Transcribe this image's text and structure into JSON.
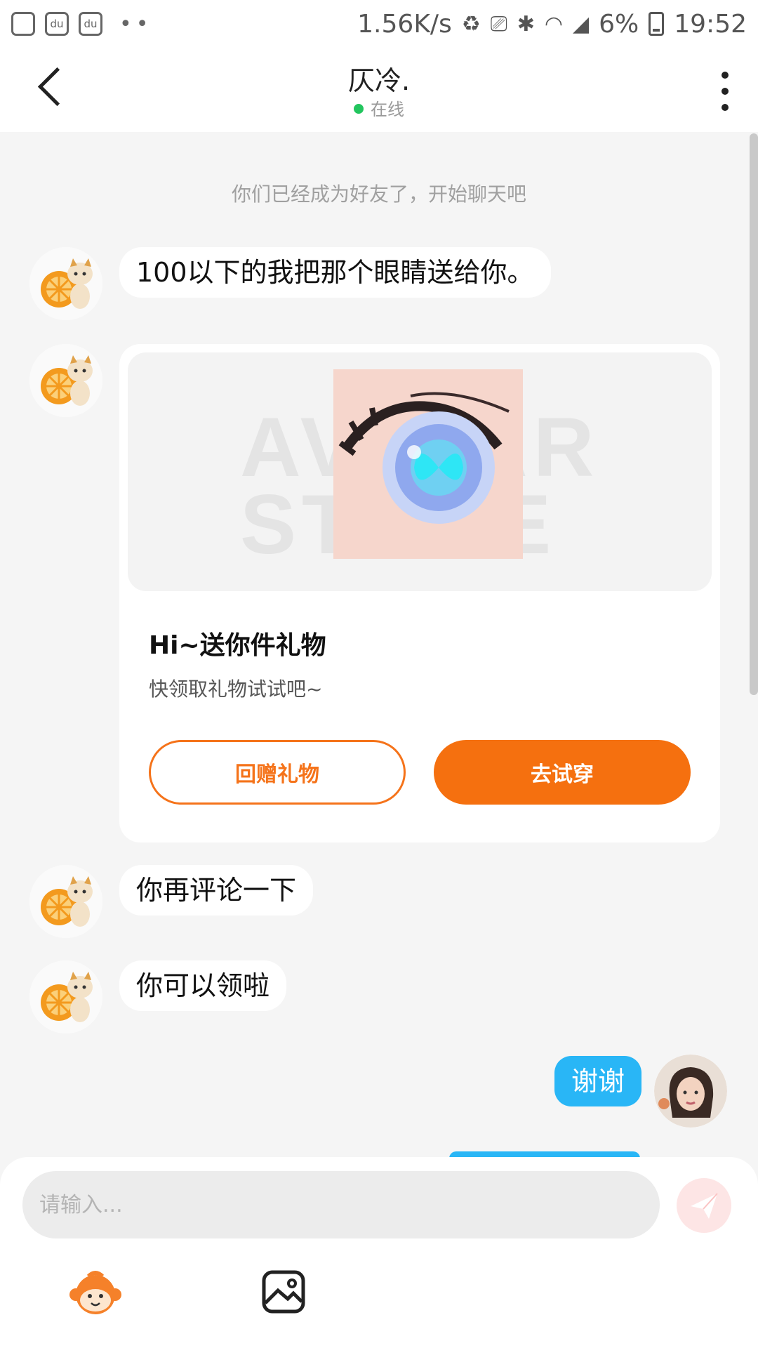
{
  "status_bar": {
    "speed": "1.56K/s",
    "battery": "6%",
    "time": "19:52",
    "icons": [
      "screen-record-icon",
      "baidu-icon",
      "baidu-icon",
      "more-dots-icon",
      "battery-saver-icon",
      "cast-icon",
      "bluetooth-icon",
      "wifi-icon",
      "signal-icon",
      "battery-icon"
    ]
  },
  "header": {
    "title": "仄冷.",
    "status": "在线"
  },
  "system_message": "你们已经成为好友了，开始聊天吧",
  "messages": [
    {
      "from": "them",
      "text": "100以下的我把那个眼睛送给你。"
    },
    {
      "from": "them",
      "text": "你再评论一下"
    },
    {
      "from": "them",
      "text": "你可以领啦"
    },
    {
      "from": "me",
      "text": "谢谢"
    }
  ],
  "gift_card": {
    "watermark": "AVATAR STORE",
    "title": "Hi~送你件礼物",
    "subtitle": "快领取礼物试试吧~",
    "return_gift_label": "回赠礼物",
    "try_on_label": "去试穿"
  },
  "composer": {
    "placeholder": "请输入..."
  },
  "colors": {
    "accent_orange": "#f5700f",
    "bubble_blue": "#29b6f6",
    "online_green": "#22c55e"
  }
}
